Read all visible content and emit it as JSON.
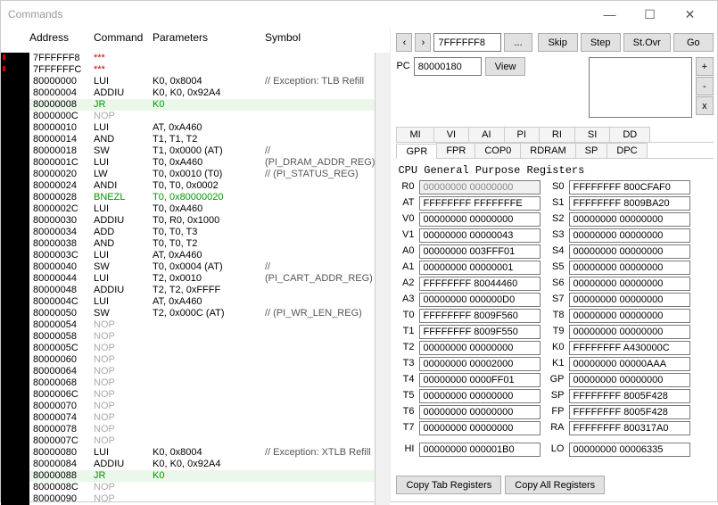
{
  "window": {
    "title": "Commands"
  },
  "headers": {
    "address": "Address",
    "command": "Command",
    "parameters": "Parameters",
    "symbol": "Symbol"
  },
  "buttons": {
    "skip": "Skip",
    "step": "Step",
    "stovr": "St.Ovr",
    "go": "Go",
    "view": "View",
    "plus": "+",
    "minus": "-",
    "x": "x",
    "ellipsis": "...",
    "copytab": "Copy Tab Registers",
    "copyall": "Copy All Registers"
  },
  "nav": {
    "left": "‹",
    "right": "›",
    "addrInput": "7FFFFFF8",
    "pcLabel": "PC",
    "pcValue": "80000180"
  },
  "tabs1": [
    "MI",
    "VI",
    "AI",
    "PI",
    "RI",
    "SI",
    "DD"
  ],
  "tabs2": [
    "GPR",
    "FPR",
    "COP0",
    "RDRAM",
    "SP",
    "DPC"
  ],
  "regTitle": "CPU General Purpose Registers",
  "regLeft": [
    {
      "n": "R0",
      "v": "00000000 00000000",
      "d": true
    },
    {
      "n": "AT",
      "v": "FFFFFFFF FFFFFFFE"
    },
    {
      "n": "V0",
      "v": "00000000 00000000"
    },
    {
      "n": "V1",
      "v": "00000000 00000043"
    },
    {
      "n": "A0",
      "v": "00000000 003FFF01"
    },
    {
      "n": "A1",
      "v": "00000000 00000001"
    },
    {
      "n": "A2",
      "v": "FFFFFFFF 80044460"
    },
    {
      "n": "A3",
      "v": "00000000 000000D0"
    },
    {
      "n": "T0",
      "v": "FFFFFFFF 8009F560"
    },
    {
      "n": "T1",
      "v": "FFFFFFFF 8009F550"
    },
    {
      "n": "T2",
      "v": "00000000 00000000"
    },
    {
      "n": "T3",
      "v": "00000000 00002000"
    },
    {
      "n": "T4",
      "v": "00000000 0000FF01"
    },
    {
      "n": "T5",
      "v": "00000000 00000000"
    },
    {
      "n": "T6",
      "v": "00000000 00000000"
    },
    {
      "n": "T7",
      "v": "00000000 00000000"
    }
  ],
  "regRight": [
    {
      "n": "S0",
      "v": "FFFFFFFF 800CFAF0"
    },
    {
      "n": "S1",
      "v": "FFFFFFFF 8009BA20"
    },
    {
      "n": "S2",
      "v": "00000000 00000000"
    },
    {
      "n": "S3",
      "v": "00000000 00000000"
    },
    {
      "n": "S4",
      "v": "00000000 00000000"
    },
    {
      "n": "S5",
      "v": "00000000 00000000"
    },
    {
      "n": "S6",
      "v": "00000000 00000000"
    },
    {
      "n": "S7",
      "v": "00000000 00000000"
    },
    {
      "n": "T8",
      "v": "00000000 00000000"
    },
    {
      "n": "T9",
      "v": "00000000 00000000"
    },
    {
      "n": "K0",
      "v": "FFFFFFFF A430000C"
    },
    {
      "n": "K1",
      "v": "00000000 00000AAA"
    },
    {
      "n": "GP",
      "v": "00000000 00000000"
    },
    {
      "n": "SP",
      "v": "FFFFFFFF 8005F428"
    },
    {
      "n": "FP",
      "v": "FFFFFFFF 8005F428"
    },
    {
      "n": "RA",
      "v": "FFFFFFFF 800317A0"
    }
  ],
  "hilo": {
    "hi": {
      "n": "HI",
      "v": "00000000 000001B0"
    },
    "lo": {
      "n": "LO",
      "v": "00000000 00006335"
    }
  },
  "rows": [
    {
      "a": "7FFFFFF8",
      "c": "***",
      "p": "",
      "s": "",
      "cls": "starred",
      "tick": true
    },
    {
      "a": "7FFFFFFC",
      "c": "***",
      "p": "",
      "s": "",
      "cls": "starred",
      "tick": true
    },
    {
      "a": "80000000",
      "c": "LUI",
      "p": "K0, 0x8004",
      "s": "// Exception: TLB Refill"
    },
    {
      "a": "80000004",
      "c": "ADDIU",
      "p": "K0, K0, 0x92A4",
      "s": ""
    },
    {
      "a": "80000008",
      "c": "JR",
      "p": "K0",
      "s": "",
      "cls": "green greenbg"
    },
    {
      "a": "8000000C",
      "c": "NOP",
      "p": "",
      "s": "",
      "cls": "nop"
    },
    {
      "a": "80000010",
      "c": "LUI",
      "p": "AT, 0xA460",
      "s": ""
    },
    {
      "a": "80000014",
      "c": "AND",
      "p": "T1, T1, T2",
      "s": ""
    },
    {
      "a": "80000018",
      "c": "SW",
      "p": "T1, 0x0000 (AT)",
      "s": "// (PI_DRAM_ADDR_REG)"
    },
    {
      "a": "8000001C",
      "c": "LUI",
      "p": "T0, 0xA460",
      "s": ""
    },
    {
      "a": "80000020",
      "c": "LW",
      "p": "T0, 0x0010 (T0)",
      "s": "// (PI_STATUS_REG)"
    },
    {
      "a": "80000024",
      "c": "ANDI",
      "p": "T0, T0, 0x0002",
      "s": ""
    },
    {
      "a": "80000028",
      "c": "BNEZL",
      "p": "T0, 0x80000020",
      "s": "",
      "cls": "green"
    },
    {
      "a": "8000002C",
      "c": "LUI",
      "p": "T0, 0xA460",
      "s": ""
    },
    {
      "a": "80000030",
      "c": "ADDIU",
      "p": "T0, R0, 0x1000",
      "s": ""
    },
    {
      "a": "80000034",
      "c": "ADD",
      "p": "T0, T0, T3",
      "s": ""
    },
    {
      "a": "80000038",
      "c": "AND",
      "p": "T0, T0, T2",
      "s": ""
    },
    {
      "a": "8000003C",
      "c": "LUI",
      "p": "AT, 0xA460",
      "s": ""
    },
    {
      "a": "80000040",
      "c": "SW",
      "p": "T0, 0x0004 (AT)",
      "s": "// (PI_CART_ADDR_REG)"
    },
    {
      "a": "80000044",
      "c": "LUI",
      "p": "T2, 0x0010",
      "s": ""
    },
    {
      "a": "80000048",
      "c": "ADDIU",
      "p": "T2, T2, 0xFFFF",
      "s": ""
    },
    {
      "a": "8000004C",
      "c": "LUI",
      "p": "AT, 0xA460",
      "s": ""
    },
    {
      "a": "80000050",
      "c": "SW",
      "p": "T2, 0x000C (AT)",
      "s": "// (PI_WR_LEN_REG)"
    },
    {
      "a": "80000054",
      "c": "NOP",
      "p": "",
      "s": "",
      "cls": "nop"
    },
    {
      "a": "80000058",
      "c": "NOP",
      "p": "",
      "s": "",
      "cls": "nop"
    },
    {
      "a": "8000005C",
      "c": "NOP",
      "p": "",
      "s": "",
      "cls": "nop"
    },
    {
      "a": "80000060",
      "c": "NOP",
      "p": "",
      "s": "",
      "cls": "nop"
    },
    {
      "a": "80000064",
      "c": "NOP",
      "p": "",
      "s": "",
      "cls": "nop"
    },
    {
      "a": "80000068",
      "c": "NOP",
      "p": "",
      "s": "",
      "cls": "nop"
    },
    {
      "a": "8000006C",
      "c": "NOP",
      "p": "",
      "s": "",
      "cls": "nop"
    },
    {
      "a": "80000070",
      "c": "NOP",
      "p": "",
      "s": "",
      "cls": "nop"
    },
    {
      "a": "80000074",
      "c": "NOP",
      "p": "",
      "s": "",
      "cls": "nop"
    },
    {
      "a": "80000078",
      "c": "NOP",
      "p": "",
      "s": "",
      "cls": "nop"
    },
    {
      "a": "8000007C",
      "c": "NOP",
      "p": "",
      "s": "",
      "cls": "nop"
    },
    {
      "a": "80000080",
      "c": "LUI",
      "p": "K0, 0x8004",
      "s": "// Exception: XTLB Refill"
    },
    {
      "a": "80000084",
      "c": "ADDIU",
      "p": "K0, K0, 0x92A4",
      "s": ""
    },
    {
      "a": "80000088",
      "c": "JR",
      "p": "K0",
      "s": "",
      "cls": "green greenbg"
    },
    {
      "a": "8000008C",
      "c": "NOP",
      "p": "",
      "s": "",
      "cls": "nop"
    },
    {
      "a": "80000090",
      "c": "NOP",
      "p": "",
      "s": "",
      "cls": "nop"
    }
  ]
}
